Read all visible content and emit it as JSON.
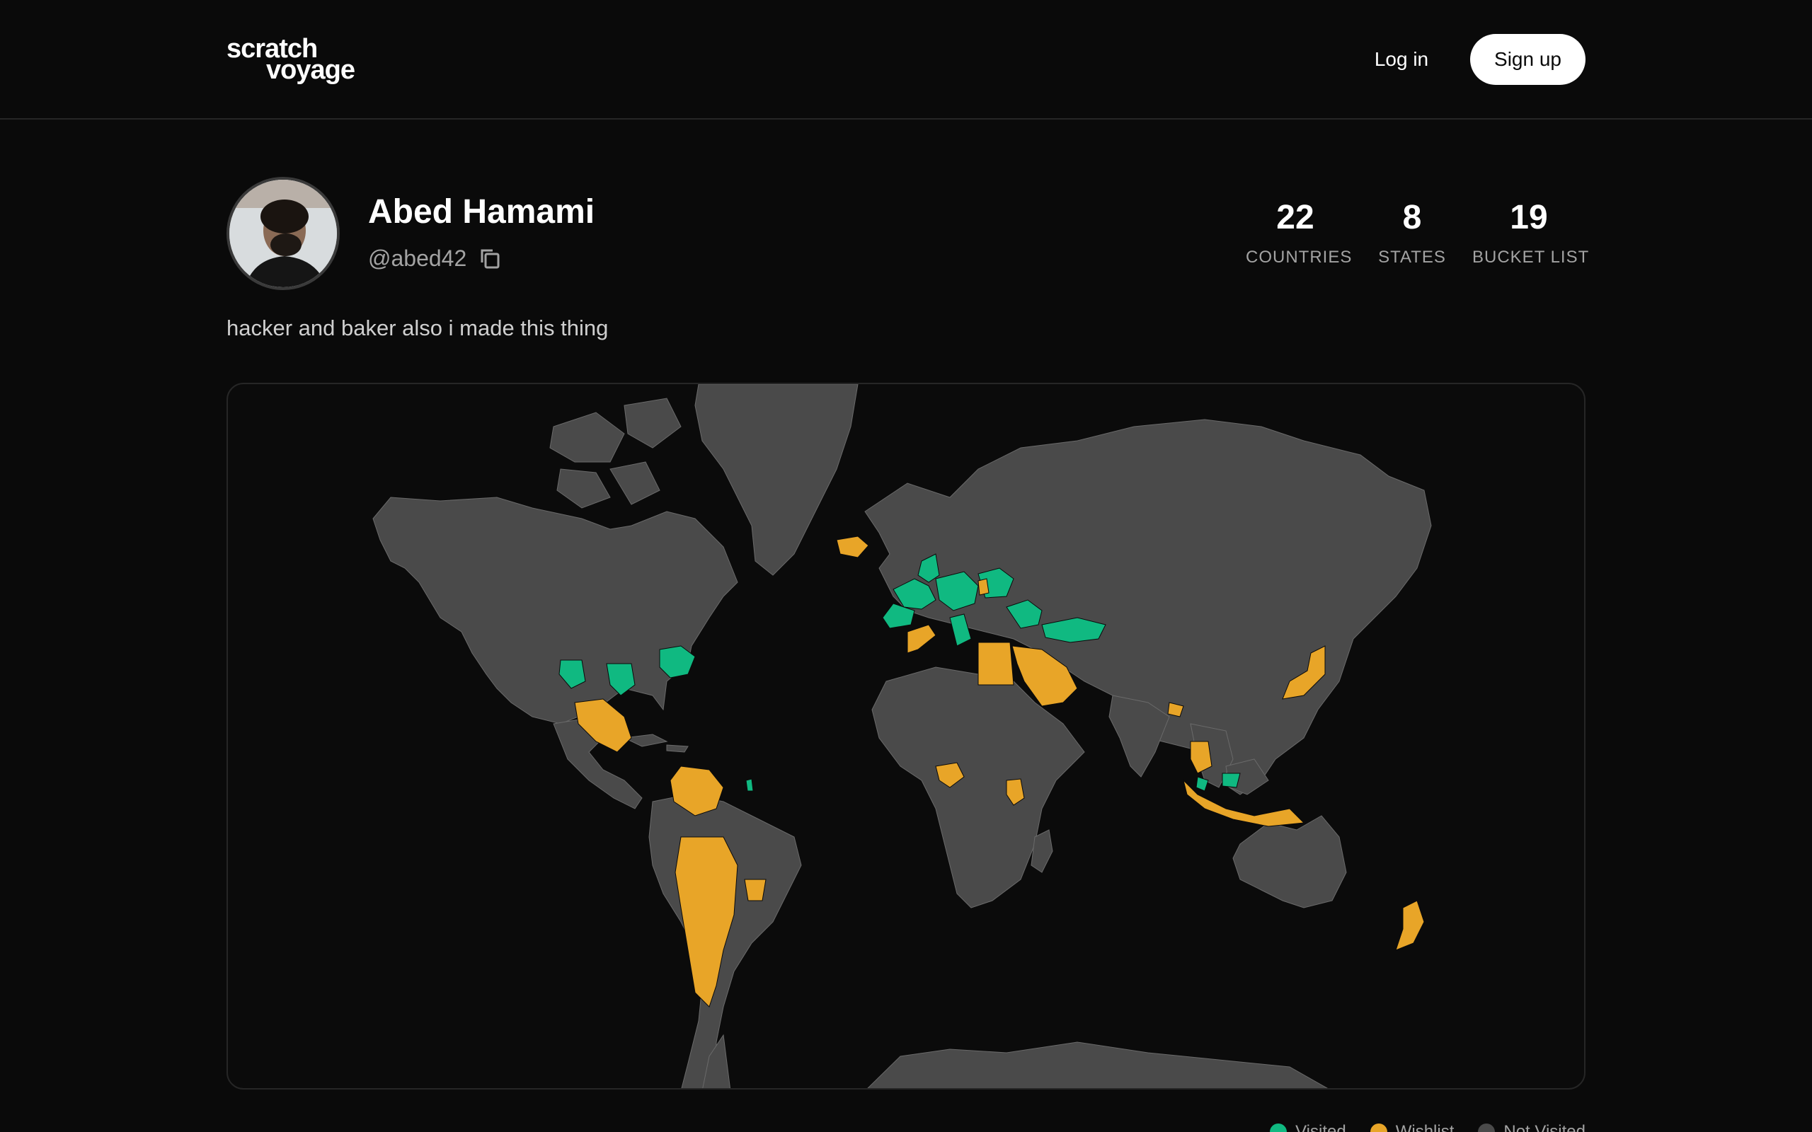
{
  "brand": {
    "line1": "scratch",
    "line2": "voyage"
  },
  "nav": {
    "login": "Log in",
    "signup": "Sign up"
  },
  "profile": {
    "name": "Abed Hamami",
    "handle": "@abed42",
    "bio": "hacker and baker also i made this thing"
  },
  "stats": [
    {
      "value": "22",
      "label": "COUNTRIES"
    },
    {
      "value": "8",
      "label": "STATES"
    },
    {
      "value": "19",
      "label": "BUCKET LIST"
    }
  ],
  "legend": [
    {
      "label": "Visited",
      "color": "#10b981"
    },
    {
      "label": "Wishlist",
      "color": "#e8a528"
    },
    {
      "label": "Not Visited",
      "color": "#4a4a4a"
    }
  ],
  "colors": {
    "visited": "#10b981",
    "wishlist": "#e8a528",
    "land": "#4a4a4a",
    "background": "#0a0a0a"
  }
}
